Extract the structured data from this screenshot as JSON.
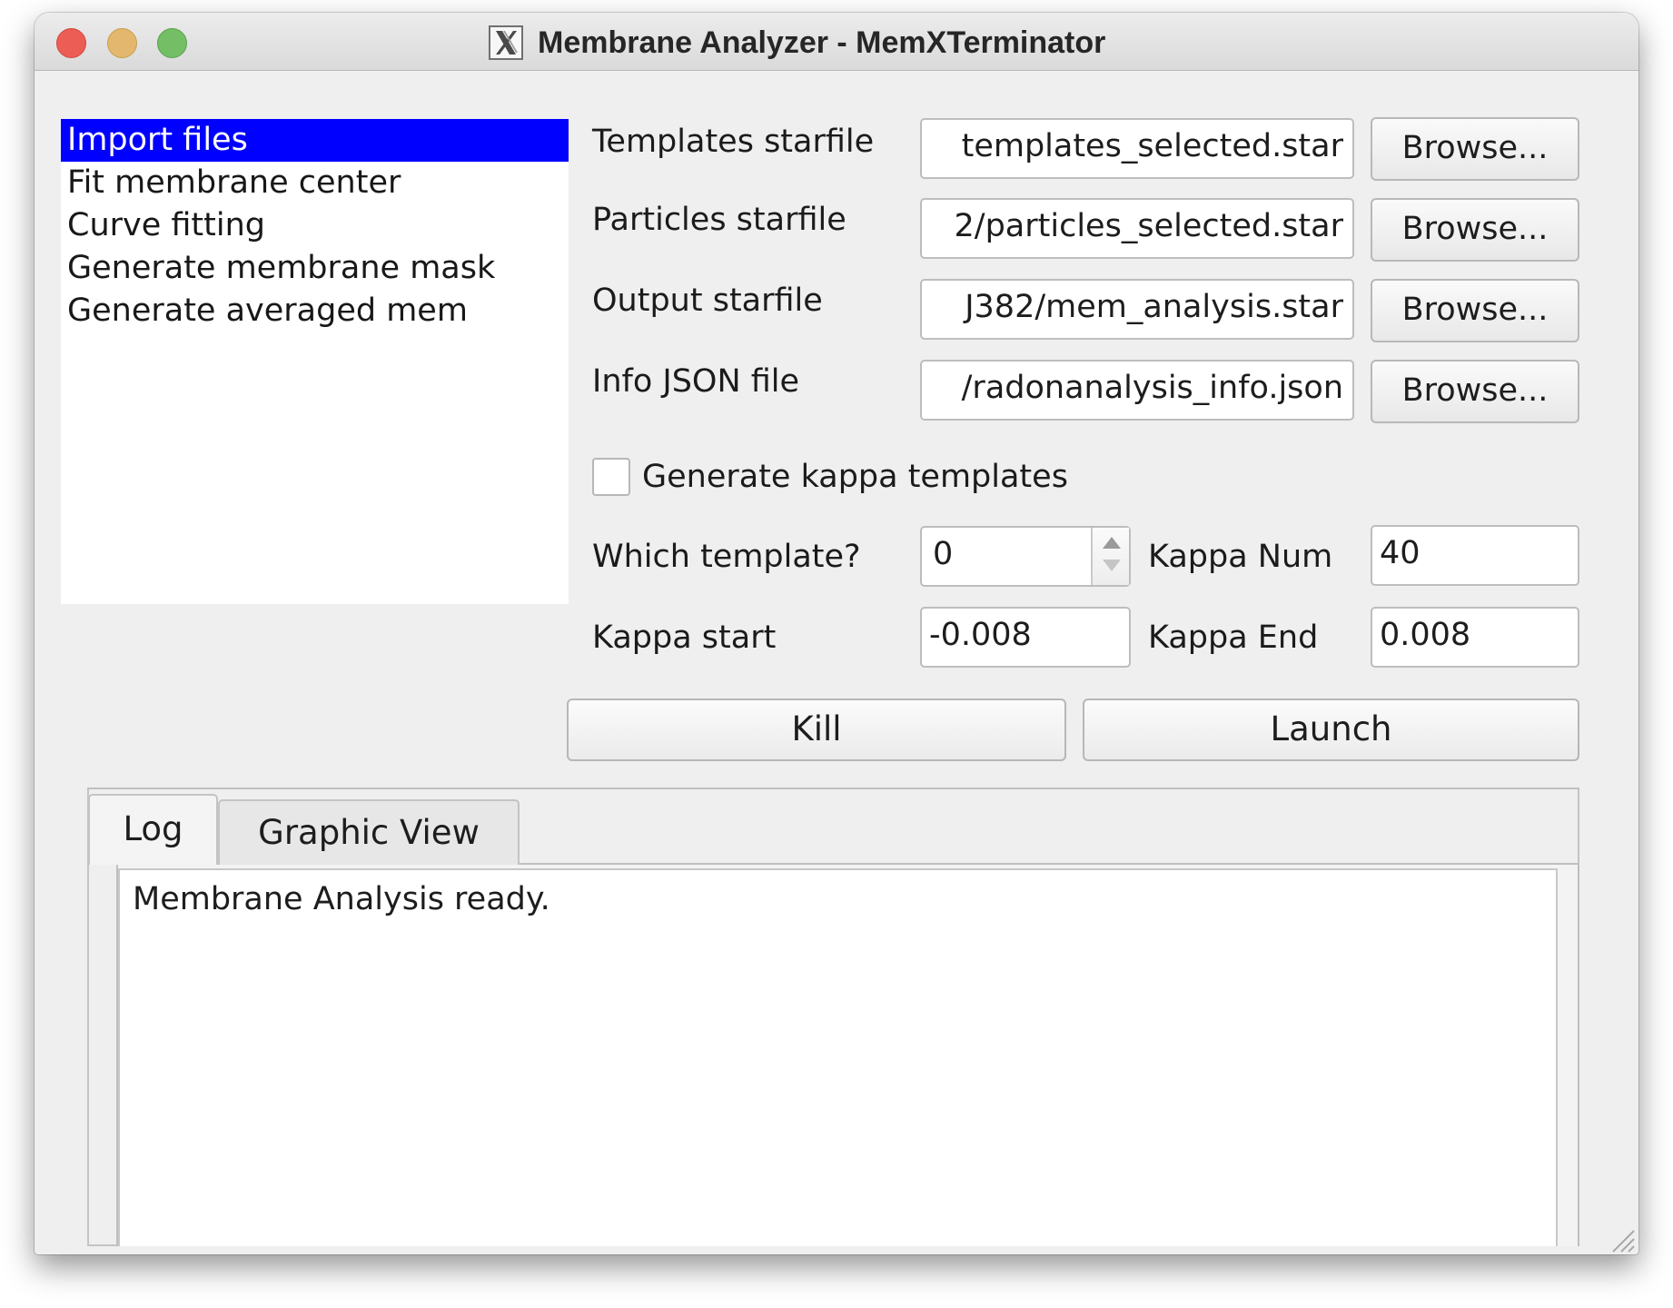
{
  "window": {
    "title": "Membrane Analyzer - MemXTerminator"
  },
  "sidebar": {
    "items": [
      {
        "label": "Import files",
        "selected": true
      },
      {
        "label": "Fit membrane center",
        "selected": false
      },
      {
        "label": "Curve fitting",
        "selected": false
      },
      {
        "label": "Generate membrane mask",
        "selected": false
      },
      {
        "label": "Generate averaged mem",
        "selected": false
      }
    ]
  },
  "form": {
    "templates_starfile": {
      "label": "Templates starfile",
      "value": "templates_selected.star",
      "button_label": "Browse..."
    },
    "particles_starfile": {
      "label": "Particles starfile",
      "value": "2/particles_selected.star",
      "button_label": "Browse..."
    },
    "output_starfile": {
      "label": "Output starfile",
      "value": "J382/mem_analysis.star",
      "button_label": "Browse..."
    },
    "info_json_file": {
      "label": "Info JSON file",
      "value": "/radonanalysis_info.json",
      "button_label": "Browse..."
    },
    "generate_kappa_templates": {
      "label": "Generate kappa templates",
      "checked": false
    },
    "which_template": {
      "label": "Which template?",
      "value": "0"
    },
    "kappa_num": {
      "label": "Kappa Num",
      "value": "40"
    },
    "kappa_start": {
      "label": "Kappa start",
      "value": "-0.008"
    },
    "kappa_end": {
      "label": "Kappa End",
      "value": "0.008"
    }
  },
  "actions": {
    "kill_label": "Kill",
    "launch_label": "Launch"
  },
  "tabs": [
    {
      "label": "Log",
      "active": true
    },
    {
      "label": "Graphic View",
      "active": false
    }
  ],
  "log": {
    "text": "Membrane Analysis ready."
  },
  "colors": {
    "selection": "#0000ff",
    "window_background": "#efefef",
    "close_button": "#ec5d55",
    "minimize_button": "#e3b76d",
    "maximize_button": "#74be66"
  }
}
